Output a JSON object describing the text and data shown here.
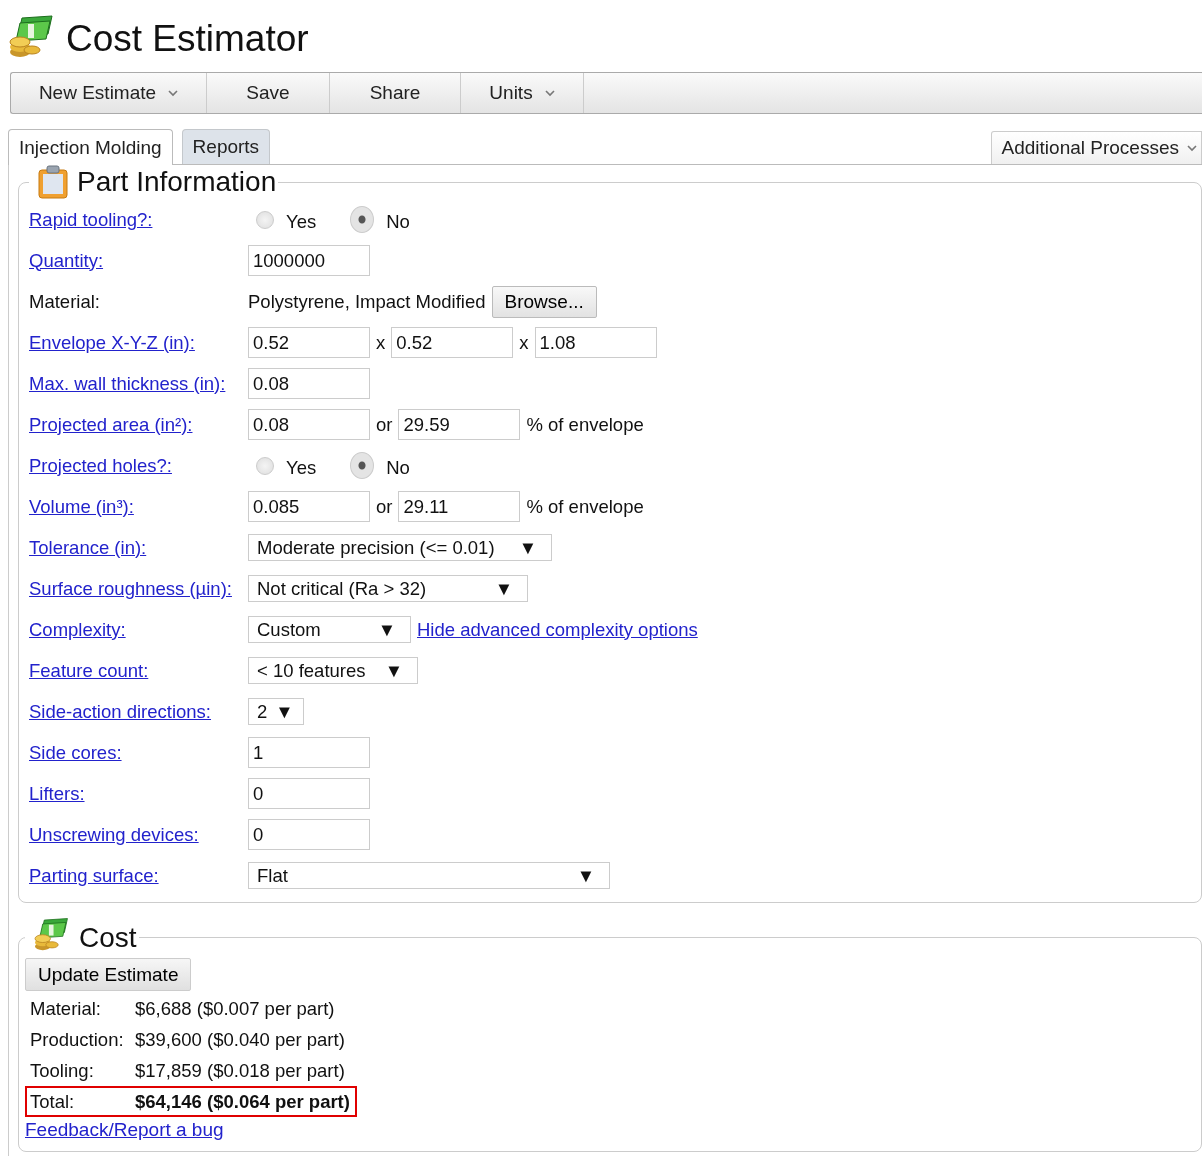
{
  "app": {
    "title": "Cost Estimator"
  },
  "toolbar": [
    {
      "label": "New Estimate",
      "dropdown": true
    },
    {
      "label": "Save",
      "dropdown": false
    },
    {
      "label": "Share",
      "dropdown": false
    },
    {
      "label": "Units",
      "dropdown": true
    }
  ],
  "tabs": [
    {
      "label": "Injection Molding",
      "selected": true
    },
    {
      "label": "Reports",
      "selected": false
    }
  ],
  "additional_processes": {
    "label": "Additional Processes"
  },
  "part_information": {
    "title": "Part Information",
    "rows": [
      {
        "kind": "radio",
        "label": "Rapid tooling?:",
        "link": true,
        "options": [
          {
            "label": "Yes",
            "selected": false
          },
          {
            "label": "No",
            "selected": true
          }
        ]
      },
      {
        "kind": "inputs",
        "label": "Quantity:",
        "link": true,
        "fields": [
          {
            "value": "1000000"
          }
        ]
      },
      {
        "kind": "material",
        "label": "Material:",
        "link": false,
        "value": "Polystyrene, Impact Modified",
        "button": "Browse..."
      },
      {
        "kind": "inputs",
        "label": "Envelope X-Y-Z (in):",
        "link": true,
        "fields": [
          {
            "value": "0.52"
          },
          {
            "prefix": "x",
            "value": "0.52"
          },
          {
            "prefix": "x",
            "value": "1.08"
          }
        ]
      },
      {
        "kind": "inputs",
        "label": "Max. wall thickness (in):",
        "link": true,
        "fields": [
          {
            "value": "0.08"
          }
        ]
      },
      {
        "kind": "inputs",
        "label": "Projected area (in²):",
        "link": true,
        "fields": [
          {
            "value": "0.08"
          },
          {
            "prefix": "or",
            "value": "29.59"
          }
        ],
        "suffix": "% of envelope"
      },
      {
        "kind": "radio",
        "label": "Projected holes?:",
        "link": true,
        "options": [
          {
            "label": "Yes",
            "selected": false
          },
          {
            "label": "No",
            "selected": true
          }
        ]
      },
      {
        "kind": "inputs",
        "label": "Volume (in³):",
        "link": true,
        "fields": [
          {
            "value": "0.085"
          },
          {
            "prefix": "or",
            "value": "29.11"
          }
        ],
        "suffix": "% of envelope"
      },
      {
        "kind": "select",
        "label": "Tolerance (in):",
        "link": true,
        "value": "Moderate precision (<= 0.01)",
        "arrow": "▼"
      },
      {
        "kind": "select",
        "label": "Surface roughness (µin):",
        "link": true,
        "value": "Not critical (Ra > 32)",
        "arrow": "▼"
      },
      {
        "kind": "select",
        "label": "Complexity:",
        "link": true,
        "value": "Custom",
        "arrow": "▼",
        "action": "Hide advanced complexity options"
      },
      {
        "kind": "select",
        "label": "Feature count:",
        "link": true,
        "value": "< 10 features",
        "arrow": "▼"
      },
      {
        "kind": "select",
        "label": "Side-action directions:",
        "link": true,
        "value": "2",
        "arrow": "▼"
      },
      {
        "kind": "inputs",
        "label": "Side cores:",
        "link": true,
        "fields": [
          {
            "value": "1"
          }
        ]
      },
      {
        "kind": "inputs",
        "label": "Lifters:",
        "link": true,
        "fields": [
          {
            "value": "0"
          }
        ]
      },
      {
        "kind": "inputs",
        "label": "Unscrewing devices:",
        "link": true,
        "fields": [
          {
            "value": "0"
          }
        ]
      },
      {
        "kind": "select",
        "label": "Parting surface:",
        "link": true,
        "value": "Flat",
        "arrow": "▼"
      }
    ]
  },
  "cost": {
    "title": "Cost",
    "button": "Update Estimate",
    "rows": [
      {
        "label": "Material:",
        "value": "$6,688 ($0.007 per part)",
        "highlighted": false
      },
      {
        "label": "Production:",
        "value": "$39,600 ($0.040 per part)",
        "highlighted": false
      },
      {
        "label": "Tooling:",
        "value": "$17,859 ($0.018 per part)",
        "highlighted": false
      },
      {
        "label": "Total:",
        "value": "$64,146 ($0.064 per part)",
        "highlighted": true
      }
    ],
    "feedback_link": "Feedback/Report a bug"
  }
}
